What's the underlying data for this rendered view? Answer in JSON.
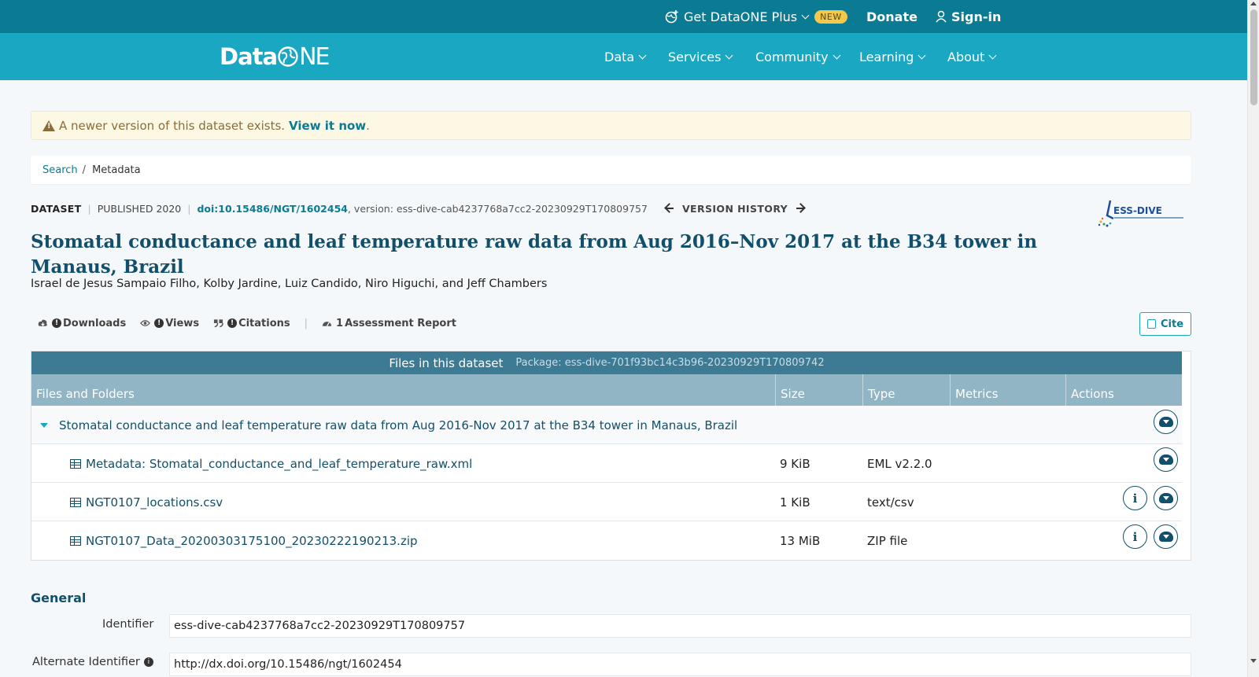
{
  "topbar": {
    "get_plus": "Get DataONE Plus",
    "new_badge": "NEW",
    "donate": "Donate",
    "signin": "Sign-in"
  },
  "nav": {
    "logo_data": "Data",
    "logo_ne": "NE",
    "items": [
      "Data",
      "Services",
      "Community",
      "Learning",
      "About"
    ]
  },
  "alert": {
    "text": "A newer version of this dataset exists.",
    "link": "View it now",
    "period": "."
  },
  "breadcrumb": {
    "search": "Search",
    "sep": "/",
    "current": "Metadata"
  },
  "meta": {
    "type": "DATASET",
    "published": "PUBLISHED 2020",
    "doi": "doi:10.15486/NGT/1602454",
    "version": ", version: ess-dive-cab4237768a7cc2-20230929T170809757",
    "version_history": "VERSION HISTORY",
    "repo_logo": "ESS-DIVE"
  },
  "title": "Stomatal conductance and leaf temperature raw data from Aug 2016–Nov 2017 at the B34 tower in Manaus, Brazil",
  "authors": "Israel de Jesus Sampaio Filho, Kolby Jardine, Luiz Candido, Niro Higuchi, and Jeff Chambers",
  "metrics": {
    "downloads": "Downloads",
    "views": "Views",
    "citations": "Citations",
    "assessment_count": "1",
    "assessment": "Assessment Report",
    "cite": "Cite"
  },
  "files": {
    "heading": "Files in this dataset",
    "package": "Package: ess-dive-701f93bc14c3b96-20230929T170809742",
    "columns": [
      "Files and Folders",
      "Size",
      "Type",
      "Metrics",
      "Actions"
    ],
    "package_name": "Stomatal conductance and leaf temperature raw data from Aug 2016-Nov 2017 at the B34 tower in Manaus, Brazil",
    "rows": [
      {
        "name": "Metadata: Stomatal_conductance_and_leaf_temperature_raw.xml",
        "size": "9 KiB",
        "type": "EML v2.2.0"
      },
      {
        "name": "NGT0107_locations.csv",
        "size": "1 KiB",
        "type": "text/csv"
      },
      {
        "name": "NGT0107_Data_20200303175100_20230222190213.zip",
        "size": "13 MiB",
        "type": "ZIP file"
      }
    ]
  },
  "general": {
    "title": "General",
    "identifier_label": "Identifier",
    "identifier_value": "ess-dive-cab4237768a7cc2-20230929T170809757",
    "alt_label": "Alternate Identifier",
    "alt_value": "http://dx.doi.org/10.15486/ngt/1602454"
  },
  "colors": {
    "topbar": "#0b7b93",
    "navbar": "#19a7c2",
    "title": "#124f6a",
    "table_head": "#3d7a94",
    "table_subhead": "#91b5c4"
  }
}
